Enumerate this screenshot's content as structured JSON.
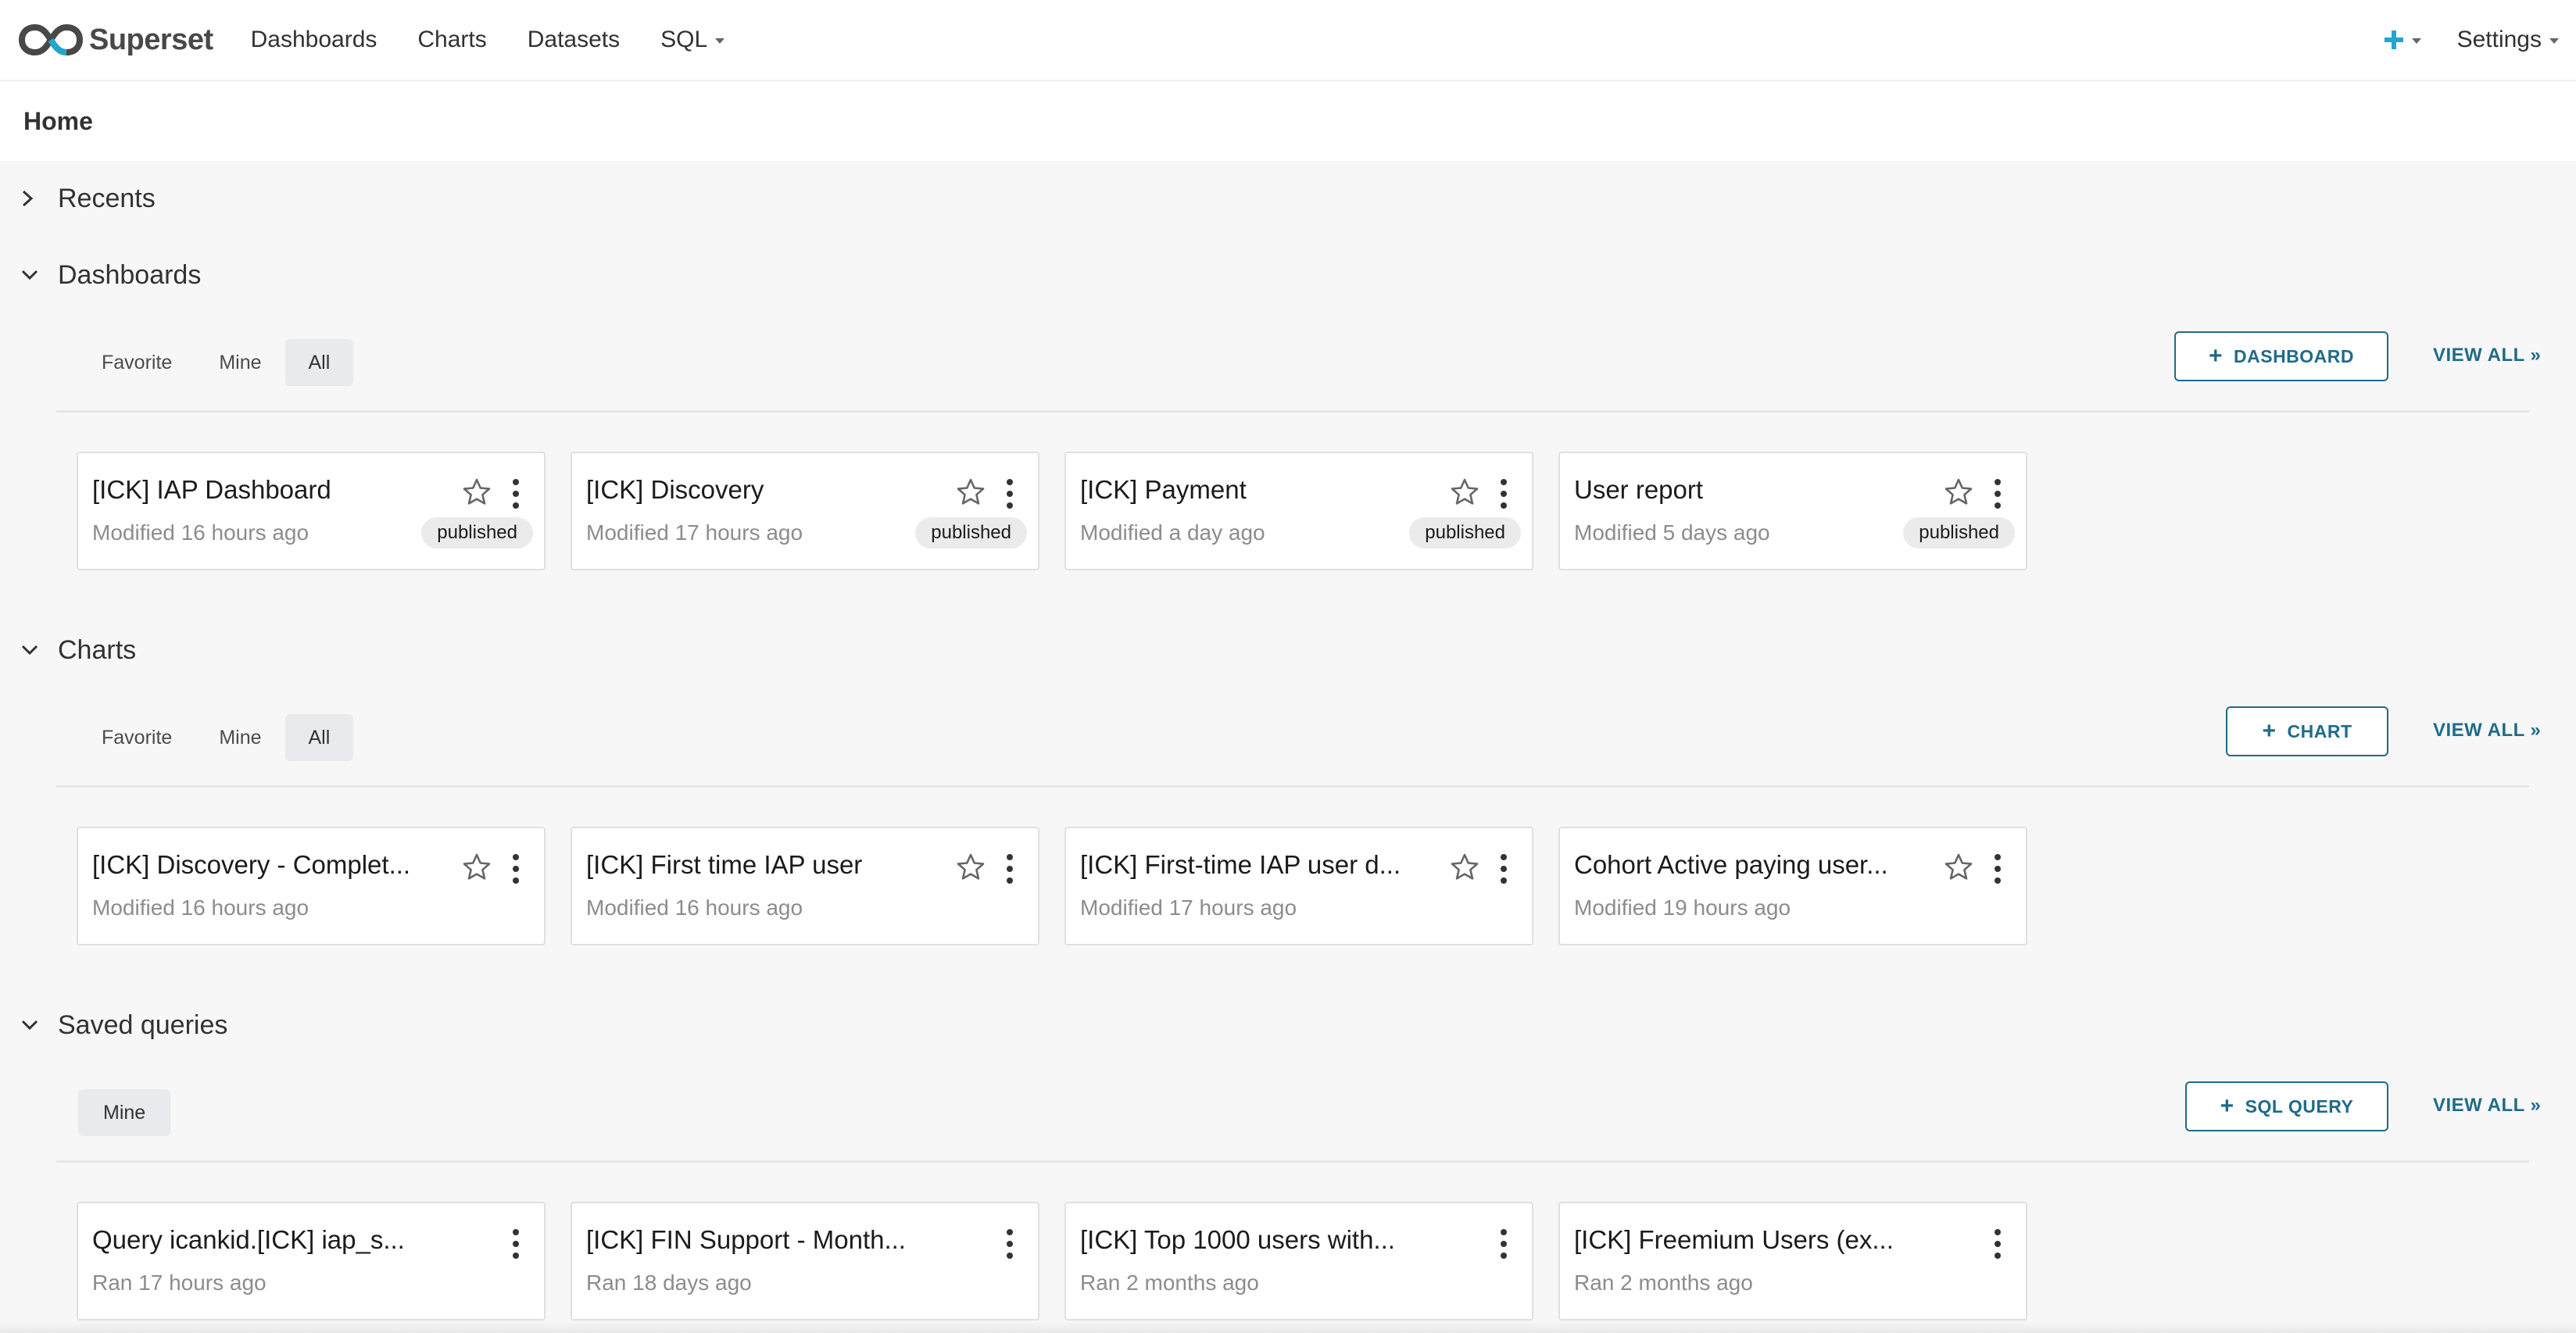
{
  "nav": {
    "brand": "Superset",
    "items": [
      {
        "label": "Dashboards"
      },
      {
        "label": "Charts"
      },
      {
        "label": "Datasets"
      },
      {
        "label": "SQL"
      }
    ],
    "settings_label": "Settings",
    "accent_color": "#20a7c9"
  },
  "home": {
    "title": "Home"
  },
  "sections": {
    "recents": {
      "title": "Recents"
    },
    "dashboards": {
      "title": "Dashboards",
      "tabs": [
        "Favorite",
        "Mine",
        "All"
      ],
      "active_tab": "All",
      "add_label": "DASHBOARD",
      "view_all": "VIEW ALL »",
      "cards": [
        {
          "title": "[ICK] IAP Dashboard",
          "subtitle": "Modified 16 hours ago",
          "badge": "published"
        },
        {
          "title": "[ICK] Discovery",
          "subtitle": "Modified 17 hours ago",
          "badge": "published"
        },
        {
          "title": "[ICK] Payment",
          "subtitle": "Modified a day ago",
          "badge": "published"
        },
        {
          "title": "User report",
          "subtitle": "Modified 5 days ago",
          "badge": "published"
        }
      ]
    },
    "charts": {
      "title": "Charts",
      "tabs": [
        "Favorite",
        "Mine",
        "All"
      ],
      "active_tab": "All",
      "add_label": "CHART",
      "view_all": "VIEW ALL »",
      "cards": [
        {
          "title": "[ICK] Discovery - Complet...",
          "subtitle": "Modified 16 hours ago"
        },
        {
          "title": "[ICK] First time IAP user",
          "subtitle": "Modified 16 hours ago"
        },
        {
          "title": "[ICK] First-time IAP user d...",
          "subtitle": "Modified 17 hours ago"
        },
        {
          "title": "Cohort Active paying user...",
          "subtitle": "Modified 19 hours ago"
        }
      ]
    },
    "saved_queries": {
      "title": "Saved queries",
      "tabs": [
        "Mine"
      ],
      "active_tab": "Mine",
      "add_label": "SQL QUERY",
      "view_all": "VIEW ALL »",
      "cards": [
        {
          "title": "Query icankid.[ICK] iap_s...",
          "subtitle": "Ran 17 hours ago"
        },
        {
          "title": "[ICK] FIN Support - Month...",
          "subtitle": "Ran 18 days ago"
        },
        {
          "title": "[ICK] Top 1000 users with...",
          "subtitle": "Ran 2 months ago"
        },
        {
          "title": "[ICK] Freemium Users (ex...",
          "subtitle": "Ran 2 months ago"
        }
      ]
    }
  },
  "icons": {
    "logo": "superset-infinity-logo",
    "star": "star-outline-icon",
    "more": "vertical-ellipsis-icon",
    "chevron_right": "chevron-right-icon",
    "chevron_down": "chevron-down-icon",
    "plus": "plus-icon"
  },
  "colors": {
    "primary": "#1f6b8a",
    "logo_dark": "#484848",
    "logo_accent": "#20a7c9"
  }
}
